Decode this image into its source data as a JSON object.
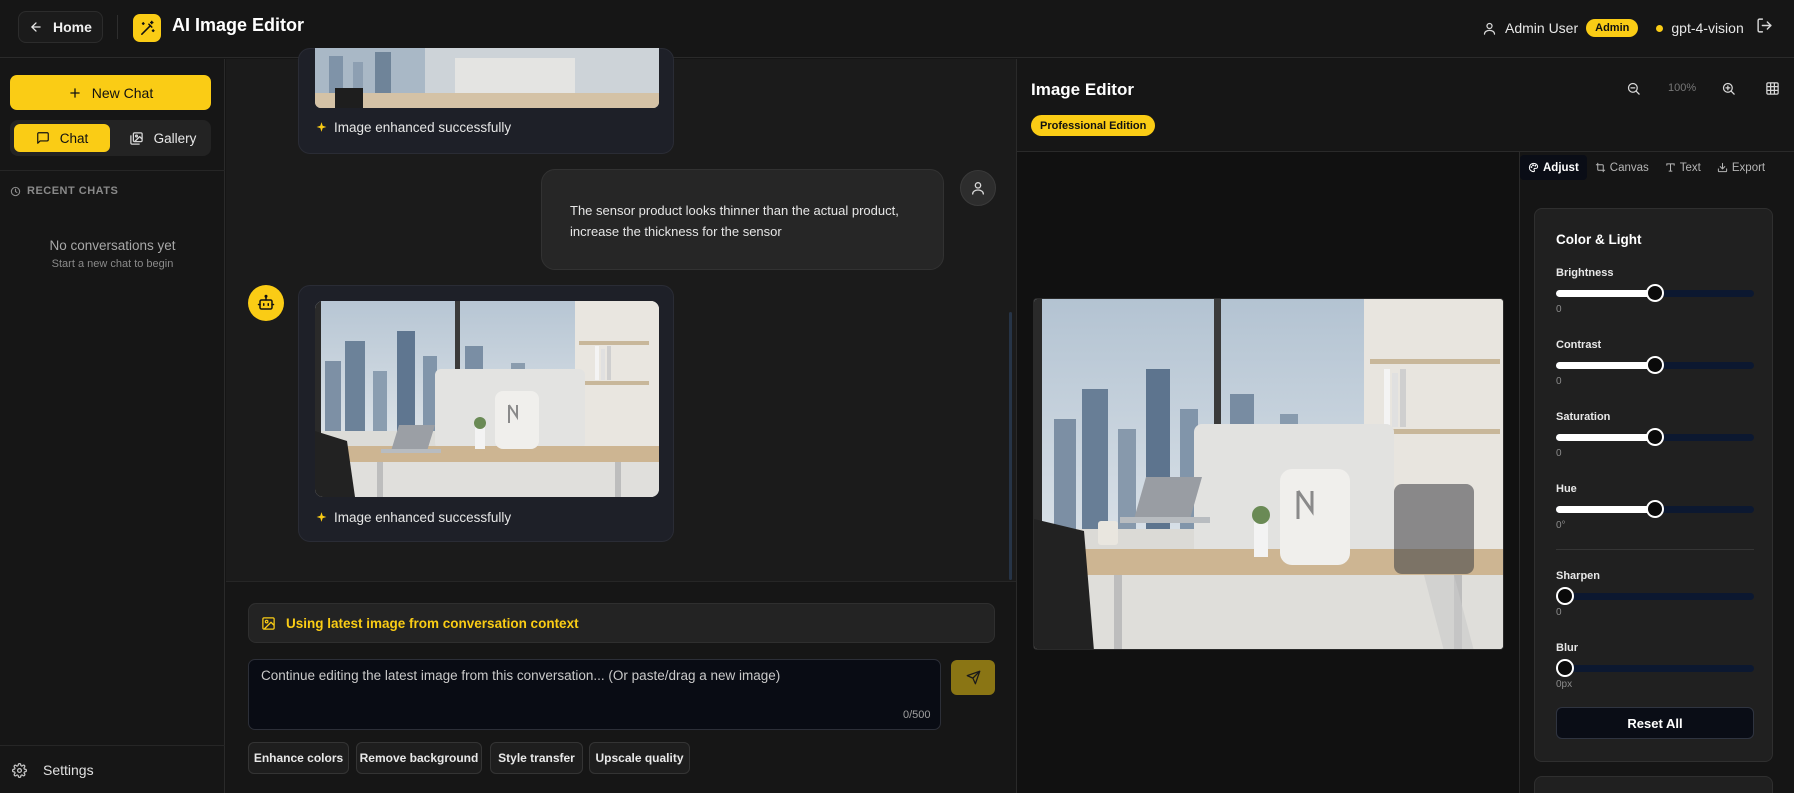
{
  "header": {
    "home_label": "Home",
    "app_title": "AI Image Editor",
    "user_name": "Admin User",
    "role_badge": "Admin",
    "model_name": "gpt-4-vision"
  },
  "sidebar": {
    "new_chat_label": "New Chat",
    "tabs": [
      {
        "label": "Chat",
        "active": true,
        "icon": "message-square-icon"
      },
      {
        "label": "Gallery",
        "active": false,
        "icon": "images-icon"
      }
    ],
    "recent_label": "RECENT CHATS",
    "empty_title": "No conversations yet",
    "empty_subtitle": "Start a new chat to begin",
    "settings_label": "Settings"
  },
  "chat": {
    "messages": [
      {
        "role": "assistant",
        "text": "Image enhanced successfully",
        "has_image": true
      },
      {
        "role": "user",
        "text": "The sensor product looks thinner than the actual product, increase the thickness for the sensor"
      },
      {
        "role": "assistant",
        "text": "Image enhanced successfully",
        "has_image": true
      }
    ]
  },
  "composer": {
    "context_banner": "Using latest image from conversation context",
    "placeholder": "Continue editing the latest image from this conversation... (Or paste/drag a new image)",
    "char_count": "0/500",
    "quick_actions": [
      "Enhance colors",
      "Remove background",
      "Style transfer",
      "Upscale quality"
    ]
  },
  "editor": {
    "title": "Image Editor",
    "edition_badge": "Professional Edition",
    "zoom_level": "100%",
    "tabs": [
      {
        "label": "Adjust",
        "active": true,
        "icon": "palette-icon"
      },
      {
        "label": "Canvas",
        "active": false,
        "icon": "crop-icon"
      },
      {
        "label": "Text",
        "active": false,
        "icon": "type-icon"
      },
      {
        "label": "Export",
        "active": false,
        "icon": "download-icon"
      }
    ],
    "section_title": "Color & Light",
    "sliders": [
      {
        "label": "Brightness",
        "value": "0",
        "fraction": 0.5
      },
      {
        "label": "Contrast",
        "value": "0",
        "fraction": 0.5
      },
      {
        "label": "Saturation",
        "value": "0",
        "fraction": 0.5
      },
      {
        "label": "Hue",
        "value": "0°",
        "fraction": 0.5
      },
      {
        "label": "Sharpen",
        "value": "0",
        "fraction": 0.0
      },
      {
        "label": "Blur",
        "value": "0px",
        "fraction": 0.0
      }
    ],
    "reset_label": "Reset All"
  },
  "colors": {
    "accent": "#facc15",
    "background": "#151515",
    "slider_track": "#0c1830"
  }
}
